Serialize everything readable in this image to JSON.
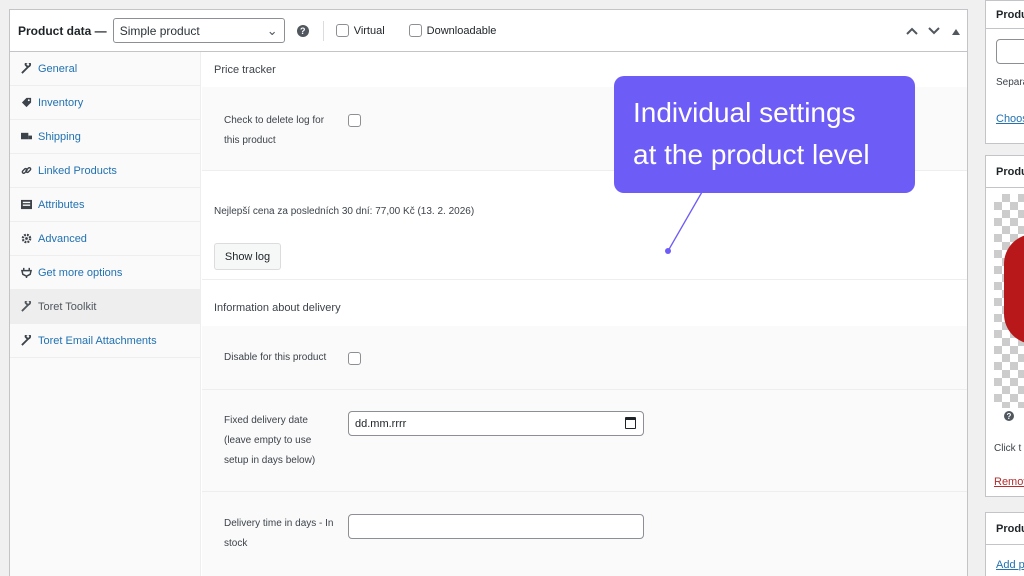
{
  "product_data": {
    "title": "Product data —",
    "type_select": "Simple product",
    "help": "?",
    "virtual_label": "Virtual",
    "downloadable_label": "Downloadable"
  },
  "tabs": [
    {
      "label": "General",
      "icon": "wrench-icon"
    },
    {
      "label": "Inventory",
      "icon": "tag-icon"
    },
    {
      "label": "Shipping",
      "icon": "truck-icon"
    },
    {
      "label": "Linked Products",
      "icon": "link-icon"
    },
    {
      "label": "Attributes",
      "icon": "list-icon"
    },
    {
      "label": "Advanced",
      "icon": "gear-icon"
    },
    {
      "label": "Get more options",
      "icon": "plugin-icon"
    },
    {
      "label": "Toret Toolkit",
      "icon": "wrench-icon"
    },
    {
      "label": "Toret Email Attachments",
      "icon": "wrench-icon"
    }
  ],
  "price_tracker": {
    "title": "Price tracker",
    "delete_log_label": "Check to delete log for this product",
    "best_price": "Nejlepší cena za posledních 30 dní: 77,00 Kč (13. 2. 2026)",
    "show_log_button": "Show log"
  },
  "delivery": {
    "title": "Information about delivery",
    "disable_label": "Disable for this product",
    "fixed_date_label": "Fixed delivery date (leave empty to use setup in days below)",
    "fixed_date_value": "dd.mm.rrrr",
    "in_stock_label": "Delivery time in days - In stock",
    "in_stock_value": ""
  },
  "sidebar": {
    "box1_head": "Produ",
    "box1_text": "Separa",
    "box1_link": "Choos",
    "box2_head": "Produ",
    "box2_help": "?",
    "box2_text": "Click t",
    "box2_remove": "Remov",
    "box3_head": "Produ",
    "box3_link": "Add p"
  },
  "callout": {
    "line1": "Individual settings",
    "line2": "at the product level"
  },
  "colors": {
    "accent": "#6e5cf6",
    "link": "#2271b1",
    "remove": "#b32d2e"
  }
}
